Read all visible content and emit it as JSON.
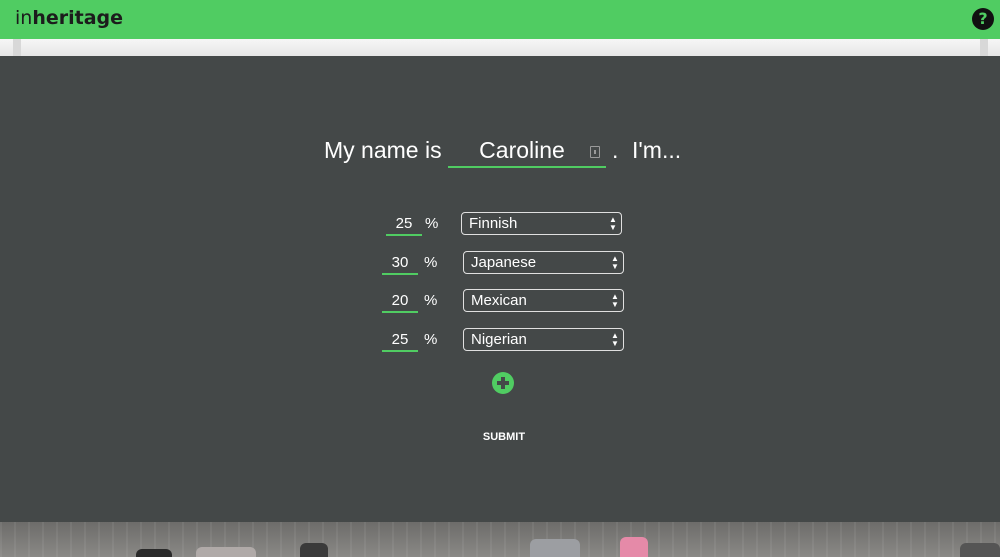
{
  "app": {
    "brand_prefix": "in",
    "brand_suffix": "heritage",
    "help_icon": "question-circle-icon",
    "accent_color": "#50cc62",
    "panel_color": "#444848"
  },
  "form": {
    "intro_prefix": "My name is",
    "name_value": "Caroline",
    "intro_dot": ".",
    "intro_suffix": "I'm...",
    "pct_sign": "%",
    "rows": [
      {
        "percent": "25",
        "heritage": "Finnish"
      },
      {
        "percent": "30",
        "heritage": "Japanese"
      },
      {
        "percent": "20",
        "heritage": "Mexican"
      },
      {
        "percent": "25",
        "heritage": "Nigerian"
      }
    ],
    "add_icon": "plus-circle-icon",
    "submit_label": "SUBMIT"
  }
}
